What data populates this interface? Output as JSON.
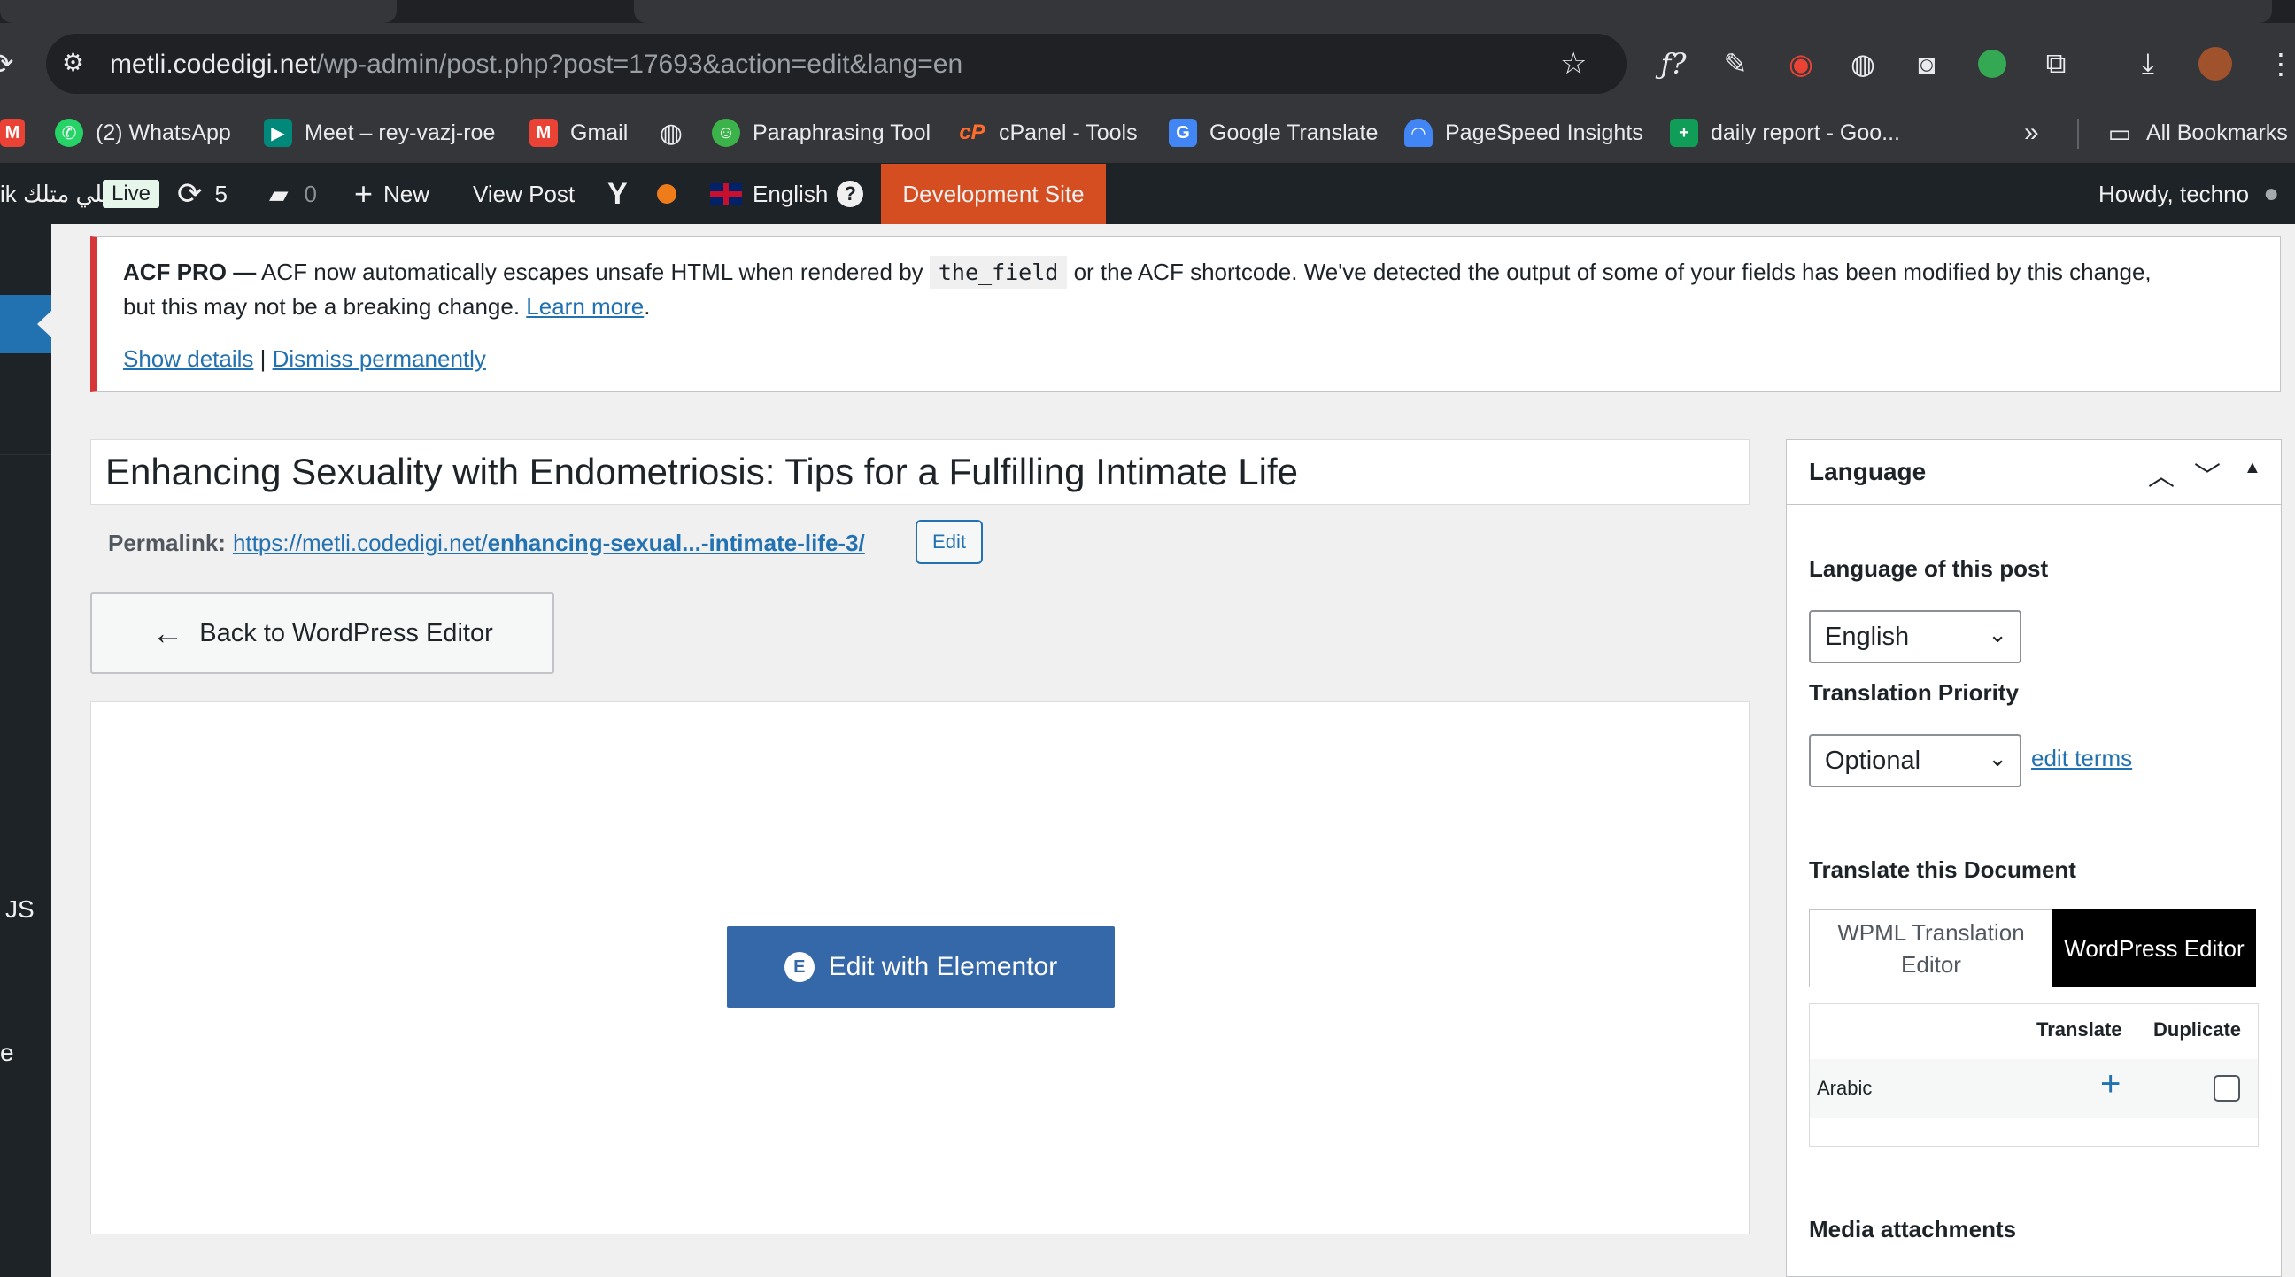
{
  "browser": {
    "url_host": "metli.codedigi.net",
    "url_path": "/wp-admin/post.php?post=17693&action=edit&lang=en",
    "bookmarks": [
      {
        "label": "(2) WhatsApp",
        "icon": "whatsapp-icon",
        "color": "#25d366"
      },
      {
        "label": "Meet – rey-vazj-roe",
        "icon": "google-meet-icon",
        "color": "#00897b"
      },
      {
        "label": "Gmail",
        "icon": "gmail-icon",
        "color": "#ea4335"
      },
      {
        "label": "Paraphrasing Tool",
        "icon": "paraphrasing-tool-icon",
        "color": "#3bb34a"
      },
      {
        "label": "cPanel - Tools",
        "icon": "cpanel-icon",
        "color": "#ff6c2c"
      },
      {
        "label": "Google Translate",
        "icon": "google-translate-icon",
        "color": "#4285f4"
      },
      {
        "label": "PageSpeed Insights",
        "icon": "pagespeed-icon",
        "color": "#4285f4"
      },
      {
        "label": "daily report - Goo...",
        "icon": "google-sheets-icon",
        "color": "#0f9d58"
      }
    ],
    "more_bookmarks": "»",
    "all_bookmarks": "All Bookmarks"
  },
  "adminbar": {
    "site_name": "ik مطلي متلك",
    "live_badge": "Live",
    "updates_count": "5",
    "comments_count": "0",
    "new_label": "New",
    "view_post": "View Post",
    "language": "English",
    "help": "?",
    "dev_site": "Development Site",
    "dev_site_color": "#d54e21",
    "howdy": "Howdy, techno"
  },
  "adminmenu": {
    "partial_items": [
      "JS",
      "e"
    ]
  },
  "notice": {
    "strong": "ACF PRO —",
    "text1": " ACF now automatically escapes unsafe HTML when rendered by ",
    "code": "the_field",
    "text2": " or the ACF shortcode. We've detected the output of some of your fields has been modified by this change,",
    "text3": "but this may not be a breaking change. ",
    "learn_more": "Learn more",
    "period": ".",
    "show_details": "Show details",
    "separator": " | ",
    "dismiss": "Dismiss permanently"
  },
  "post": {
    "title": "Enhancing Sexuality with Endometriosis: Tips for a Fulfilling Intimate Life",
    "permalink_label": "Permalink:",
    "permalink_base": "https://metli.codedigi.net/",
    "permalink_slug": "enhancing-sexual...-intimate-life-3/",
    "edit_slug_button": "Edit",
    "back_button": "Back to WordPress Editor",
    "elementor_button": "Edit with Elementor"
  },
  "language_panel": {
    "title": "Language",
    "language_of_post_label": "Language of this post",
    "language_value": "English",
    "translation_priority_label": "Translation Priority",
    "priority_value": "Optional",
    "edit_terms": "edit terms",
    "translate_document_label": "Translate this Document",
    "tab_wpml": "WPML Translation Editor",
    "tab_wp_editor": "WordPress Editor",
    "col_translate": "Translate",
    "col_duplicate": "Duplicate",
    "row_language": "Arabic",
    "media_attachments": "Media attachments"
  }
}
